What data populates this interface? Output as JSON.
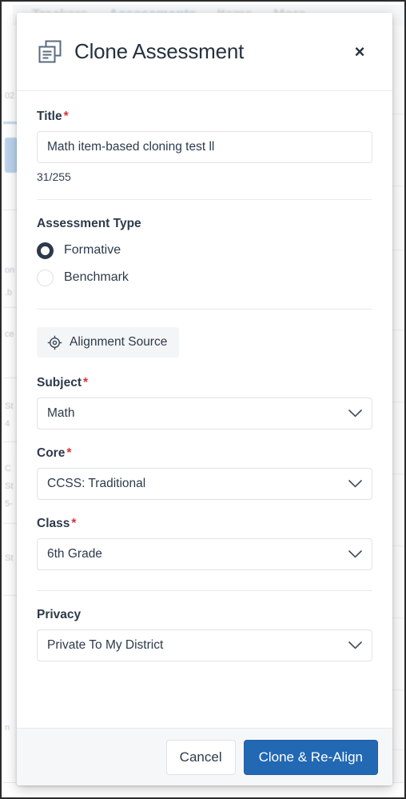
{
  "background": {
    "nav_items": [
      {
        "label": "Trackers",
        "active": false
      },
      {
        "label": "Assessments",
        "active": true
      },
      {
        "label": "Items",
        "active": false
      },
      {
        "label": "More",
        "active": false
      }
    ],
    "left_fragments": [
      "02",
      "on",
      ".b",
      "ce",
      "St",
      "4",
      "C",
      "St",
      "5-",
      "St",
      "n"
    ]
  },
  "modal": {
    "icon": "clone-document-icon",
    "title": "Clone Assessment",
    "close_label": "×",
    "title_field": {
      "label": "Title",
      "required": true,
      "value": "Math item-based cloning test ll",
      "placeholder": "",
      "char_count": "31/255"
    },
    "assessment_type": {
      "label": "Assessment Type",
      "required": false,
      "options": [
        {
          "label": "Formative",
          "selected": true
        },
        {
          "label": "Benchmark",
          "selected": false
        }
      ]
    },
    "alignment_source": {
      "label": "Alignment Source",
      "icon": "target-crosshair-icon"
    },
    "subject": {
      "label": "Subject",
      "required": true,
      "value": "Math"
    },
    "core": {
      "label": "Core",
      "required": true,
      "value": "CCSS: Traditional"
    },
    "class": {
      "label": "Class",
      "required": true,
      "value": "6th Grade"
    },
    "privacy": {
      "label": "Privacy",
      "required": false,
      "value": "Private To My District"
    },
    "footer": {
      "cancel_label": "Cancel",
      "submit_label": "Clone & Re-Align",
      "submit_color": "#2268b3"
    }
  }
}
